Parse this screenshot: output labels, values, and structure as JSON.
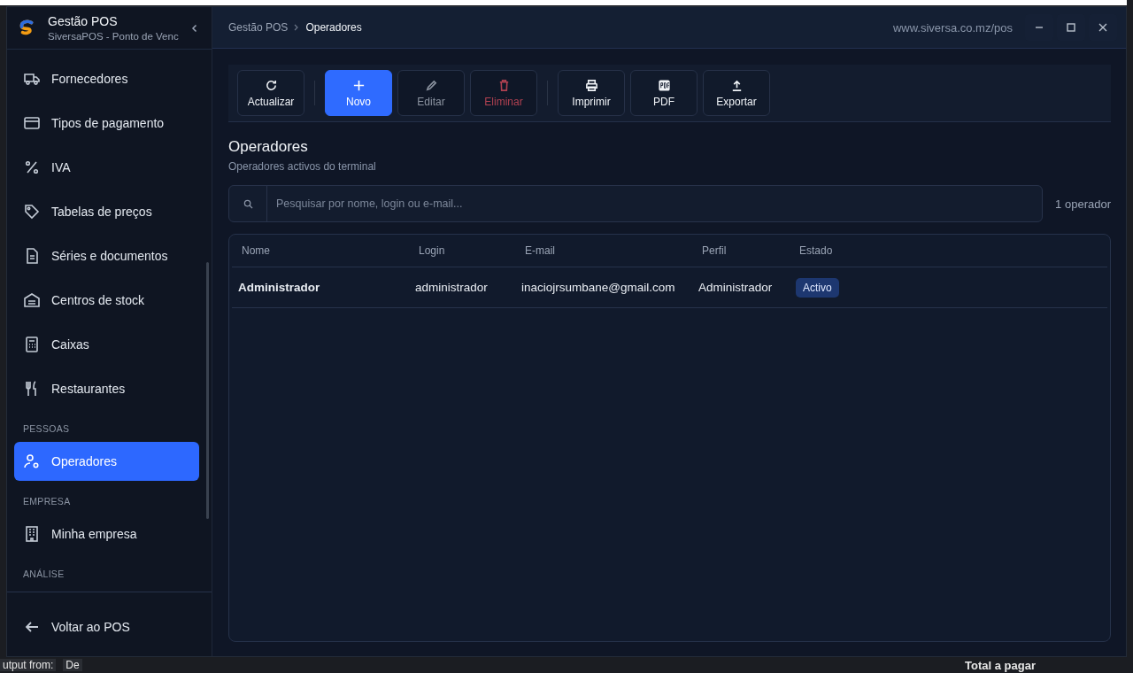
{
  "window": {
    "app_title": "Gestão POS",
    "app_subtitle": "SiversaPOS - Ponto de Venc",
    "url": "www.siversa.co.mz/pos"
  },
  "breadcrumb": [
    {
      "label": "Gestão POS",
      "selected": false
    },
    {
      "label": "Operadores",
      "selected": true
    }
  ],
  "sidebar": {
    "items": [
      {
        "kind": "item",
        "label": "Fornecedores",
        "selected": false
      },
      {
        "kind": "item",
        "label": "Tipos de pagamento",
        "selected": false
      },
      {
        "kind": "item",
        "label": "IVA",
        "selected": false
      },
      {
        "kind": "item",
        "label": "Tabelas de preços",
        "selected": false
      },
      {
        "kind": "item",
        "label": "Séries e documentos",
        "selected": false
      },
      {
        "kind": "item",
        "label": "Centros de stock",
        "selected": false
      },
      {
        "kind": "item",
        "label": "Caixas",
        "selected": false
      },
      {
        "kind": "item",
        "label": "Restaurantes",
        "selected": false
      },
      {
        "kind": "section",
        "label": "PESSOAS"
      },
      {
        "kind": "item",
        "label": "Operadores",
        "selected": true
      },
      {
        "kind": "section",
        "label": "EMPRESA"
      },
      {
        "kind": "item",
        "label": "Minha empresa",
        "selected": false
      },
      {
        "kind": "section",
        "label": "ANÁLISE"
      }
    ],
    "footer": "Voltar ao POS"
  },
  "toolbar": [
    [
      {
        "label": "Actualizar",
        "kind": "default",
        "disabled": false
      }
    ],
    [
      {
        "label": "Novo",
        "kind": "primary",
        "disabled": false
      },
      {
        "label": "Editar",
        "kind": "default",
        "disabled": true
      },
      {
        "label": "Eliminar",
        "kind": "danger",
        "disabled": true
      }
    ],
    [
      {
        "label": "Imprimir",
        "kind": "default",
        "disabled": false
      },
      {
        "label": "PDF",
        "kind": "default",
        "disabled": false
      },
      {
        "label": "Exportar",
        "kind": "default",
        "disabled": false
      }
    ]
  ],
  "page": {
    "title": "Operadores",
    "subtitle": "Operadores activos do terminal"
  },
  "search": {
    "placeholder": "Pesquisar por nome, login ou e-mail...",
    "count": "1 operador"
  },
  "table": {
    "columns": [
      "Nome",
      "Login",
      "E-mail",
      "Perfil",
      "Estado"
    ],
    "rows": [
      {
        "selected": false,
        "cells": [
          "Administrador",
          "administrador",
          "inaciojrsumbane@gmail.com",
          "Administrador"
        ],
        "status": "Activo"
      }
    ]
  },
  "background": {
    "texts": [
      "utput from:",
      "De"
    ],
    "right_text": "Total a pagar"
  }
}
